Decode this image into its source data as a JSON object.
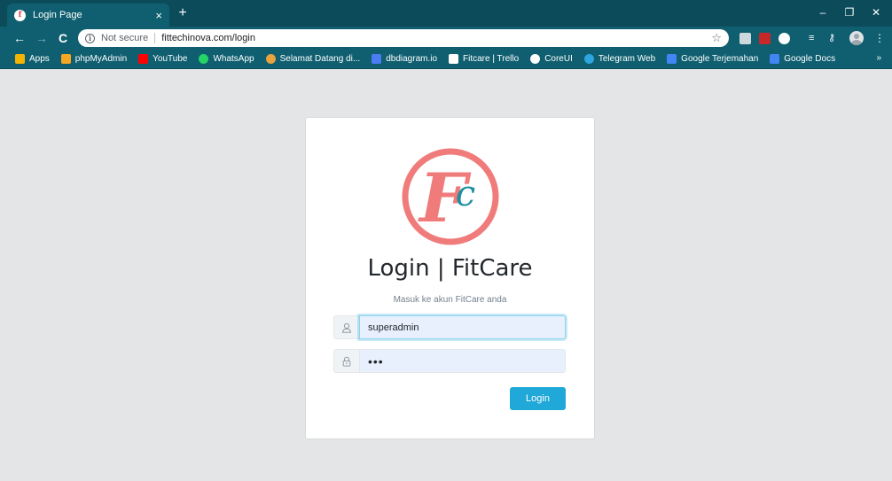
{
  "browser": {
    "tab_title": "Login Page",
    "tab_close": "×",
    "new_tab": "+",
    "security_label": "Not secure",
    "url": "fittechinova.com/login",
    "window_controls": {
      "minimize": "–",
      "restore": "❐",
      "close": "✕"
    },
    "bookmarks": [
      {
        "label": "Apps",
        "color": "#f4b400"
      },
      {
        "label": "phpMyAdmin",
        "color": "#f6a623"
      },
      {
        "label": "YouTube",
        "color": "#ff0000"
      },
      {
        "label": "WhatsApp",
        "color": "#25d366"
      },
      {
        "label": "Selamat Datang di...",
        "color": "#e8a33d"
      },
      {
        "label": "dbdiagram.io",
        "color": "#4a7cf3"
      },
      {
        "label": "Fitcare | Trello",
        "color": "#ffffff"
      },
      {
        "label": "CoreUI",
        "color": "#ffffff"
      },
      {
        "label": "Telegram Web",
        "color": "#2ca5e0"
      },
      {
        "label": "Google Terjemahan",
        "color": "#4285f4"
      },
      {
        "label": "Google Docs",
        "color": "#4285f4"
      }
    ],
    "bookmarks_overflow": "»"
  },
  "login": {
    "logo_text": "Fc",
    "title": "Login | FitCare",
    "subtitle": "Masuk ke akun FitCare anda",
    "username_value": "superadmin",
    "password_value": "•••",
    "submit_label": "Login"
  },
  "colors": {
    "chrome_dark": "#0b4b5a",
    "chrome": "#0f5f70",
    "logo_pink": "#f07b7b",
    "logo_teal": "#1d8fa0",
    "primary": "#20a8d8"
  }
}
